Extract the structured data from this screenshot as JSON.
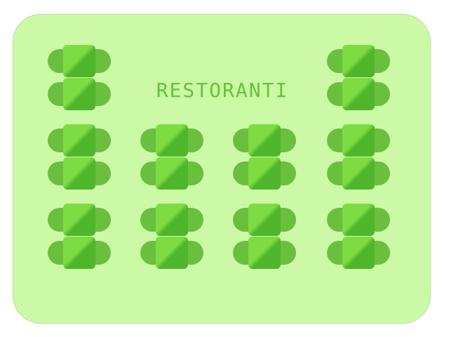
{
  "title": "RESTORANTI",
  "colors": {
    "floor": "#ccf9a6",
    "title_text": "#62c536",
    "chair": "#6bbf3f",
    "table_light": "#7edc43",
    "table_dark": "#4fb62c"
  },
  "table_pairs": [
    {
      "id": "pair-r1-c1"
    },
    {
      "id": "pair-r1-c4"
    },
    {
      "id": "pair-r2-c1"
    },
    {
      "id": "pair-r2-c2"
    },
    {
      "id": "pair-r2-c3"
    },
    {
      "id": "pair-r2-c4"
    },
    {
      "id": "pair-r3-c1"
    },
    {
      "id": "pair-r3-c2"
    },
    {
      "id": "pair-r3-c3"
    },
    {
      "id": "pair-r3-c4"
    }
  ]
}
